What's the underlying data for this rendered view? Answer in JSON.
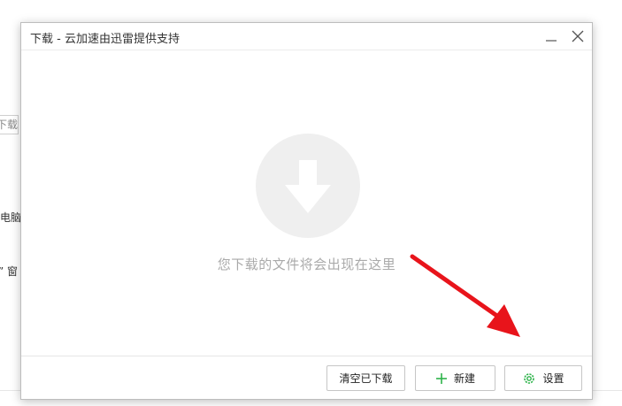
{
  "background": {
    "search_fragment": "下载",
    "side_text_1": "电脑",
    "side_text_2": "” 窗"
  },
  "dialog": {
    "title": "下载 - 云加速由迅雷提供支持",
    "minimize_icon": "minimize-icon",
    "close_icon": "close-icon",
    "empty_state": {
      "icon": "download-arrow-icon",
      "message": "您下载的文件将会出现在这里"
    },
    "footer": {
      "clear_label": "清空已下载",
      "new_label": "新建",
      "new_icon": "plus-icon",
      "settings_label": "设置",
      "settings_icon": "gear-icon"
    }
  },
  "annotation": {
    "arrow_color": "#e8141b"
  },
  "colors": {
    "accent_green": "#2db34a",
    "empty_circle": "#efefef",
    "empty_text": "#aaaaaa"
  }
}
